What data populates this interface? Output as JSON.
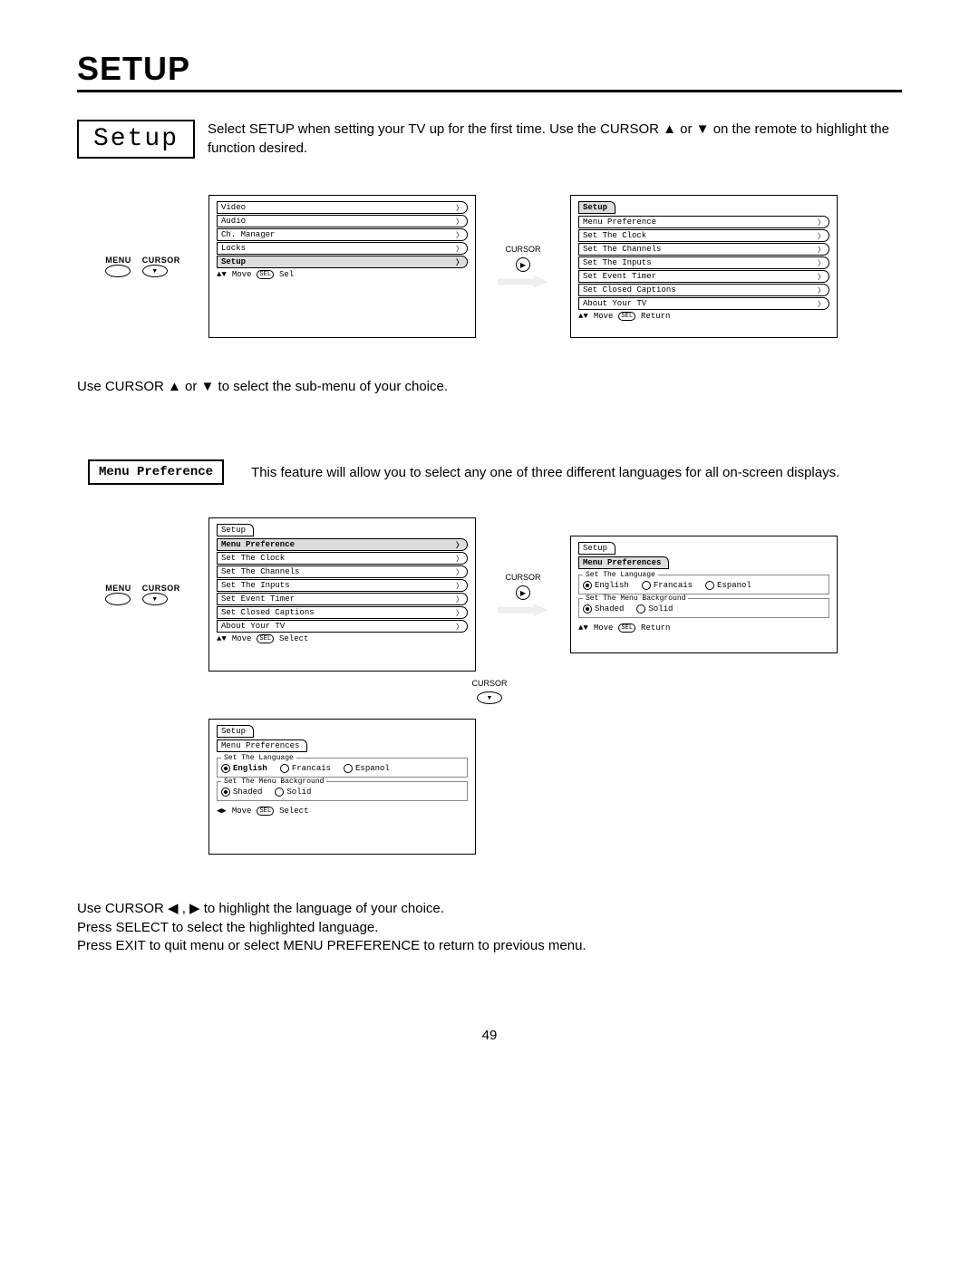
{
  "heading": "SETUP",
  "setup_label": "Setup",
  "setup_desc": "Select SETUP when setting your TV up for the first time.  Use the CURSOR ▲ or ▼ on the remote to highlight the function desired.",
  "remote": {
    "menu": "MENU",
    "cursor": "CURSOR"
  },
  "osd1": {
    "items": [
      "Video",
      "Audio",
      "Ch. Manager",
      "Locks",
      "Setup"
    ],
    "selected_index": 4,
    "footer_move": "Move",
    "footer_sel_pill": "SEL",
    "footer_sel": "Sel"
  },
  "osd2": {
    "tab": "Setup",
    "items": [
      "Menu Preference",
      "Set The Clock",
      "Set The Channels",
      "Set The Inputs",
      "Set Event Timer",
      "Set Closed Captions",
      "About Your TV"
    ],
    "footer_move": "Move",
    "footer_sel_pill": "SEL",
    "footer_ret": "Return"
  },
  "sub_text": "Use CURSOR ▲ or ▼ to select the sub-menu of your choice.",
  "mp_label": "Menu Preference",
  "mp_desc": "This feature will allow you to select any one of three different languages for all on-screen displays.",
  "osd3": {
    "tab": "Setup",
    "sel_item": "Menu Preference",
    "items": [
      "Set The Clock",
      "Set The Channels",
      "Set The Inputs",
      "Set Event Timer",
      "Set Closed Captions",
      "About Your TV"
    ],
    "footer_move": "Move",
    "footer_sel_pill": "SEL",
    "footer_sel": "Select"
  },
  "osd4": {
    "tab": "Setup",
    "sel_item": "Menu Preferences",
    "lang_legend": "Set The Language",
    "lang_opts": [
      "English",
      "Francais",
      "Espanol"
    ],
    "lang_selected": 0,
    "bg_legend": "Set The Menu Background",
    "bg_opts": [
      "Shaded",
      "Solid"
    ],
    "bg_selected": 0,
    "footer_move": "Move",
    "footer_sel_pill": "SEL",
    "footer_ret": "Return"
  },
  "osd5": {
    "tab": "Setup",
    "sub_tab": "Menu Preferences",
    "lang_legend": "Set The Language",
    "lang_opts": [
      "English",
      "Francais",
      "Espanol"
    ],
    "lang_selected": 0,
    "lang_bold": true,
    "bg_legend": "Set The Menu Background",
    "bg_opts": [
      "Shaded",
      "Solid"
    ],
    "bg_selected": 0,
    "footer_move": "Move",
    "footer_sel_pill": "SEL",
    "footer_sel": "Select"
  },
  "bottom_text_1": "Use CURSOR ◀ , ▶ to highlight the language of your choice.",
  "bottom_text_2": "Press SELECT to select the highlighted language.",
  "bottom_text_3": "Press EXIT to quit menu or select MENU PREFERENCE to return to previous menu.",
  "cursor_label": "CURSOR",
  "page_number": "49"
}
